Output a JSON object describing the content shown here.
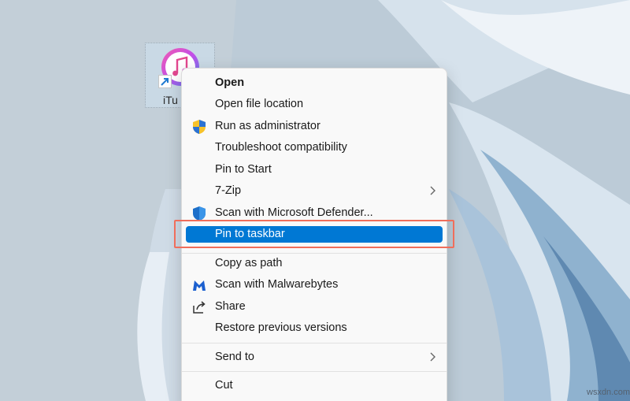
{
  "desktop": {
    "icon_label": "iTu",
    "watermark": "wsxdn.com"
  },
  "context_menu": {
    "items": [
      {
        "label": "Open",
        "icon": null,
        "bold": true,
        "submenu": false
      },
      {
        "label": "Open file location",
        "icon": null,
        "submenu": false
      },
      {
        "label": "Run as administrator",
        "icon": "uac-shield-icon",
        "submenu": false
      },
      {
        "label": "Troubleshoot compatibility",
        "icon": null,
        "submenu": false
      },
      {
        "label": "Pin to Start",
        "icon": null,
        "submenu": false
      },
      {
        "label": "7-Zip",
        "icon": null,
        "submenu": true
      },
      {
        "label": "Scan with Microsoft Defender...",
        "icon": "defender-shield-icon",
        "submenu": false
      },
      {
        "label": "Pin to taskbar",
        "icon": null,
        "highlighted": true,
        "submenu": false
      },
      {
        "label": "Copy as path",
        "icon": null,
        "submenu": false
      },
      {
        "label": "Scan with Malwarebytes",
        "icon": "malwarebytes-icon",
        "submenu": false
      },
      {
        "label": "Share",
        "icon": "share-icon",
        "submenu": false
      },
      {
        "label": "Restore previous versions",
        "icon": null,
        "submenu": false
      },
      {
        "label": "Send to",
        "icon": null,
        "submenu": true
      },
      {
        "label": "Cut",
        "icon": null,
        "submenu": false
      }
    ],
    "highlight_color": "#0078d4",
    "callout_color": "#f06e5b"
  }
}
